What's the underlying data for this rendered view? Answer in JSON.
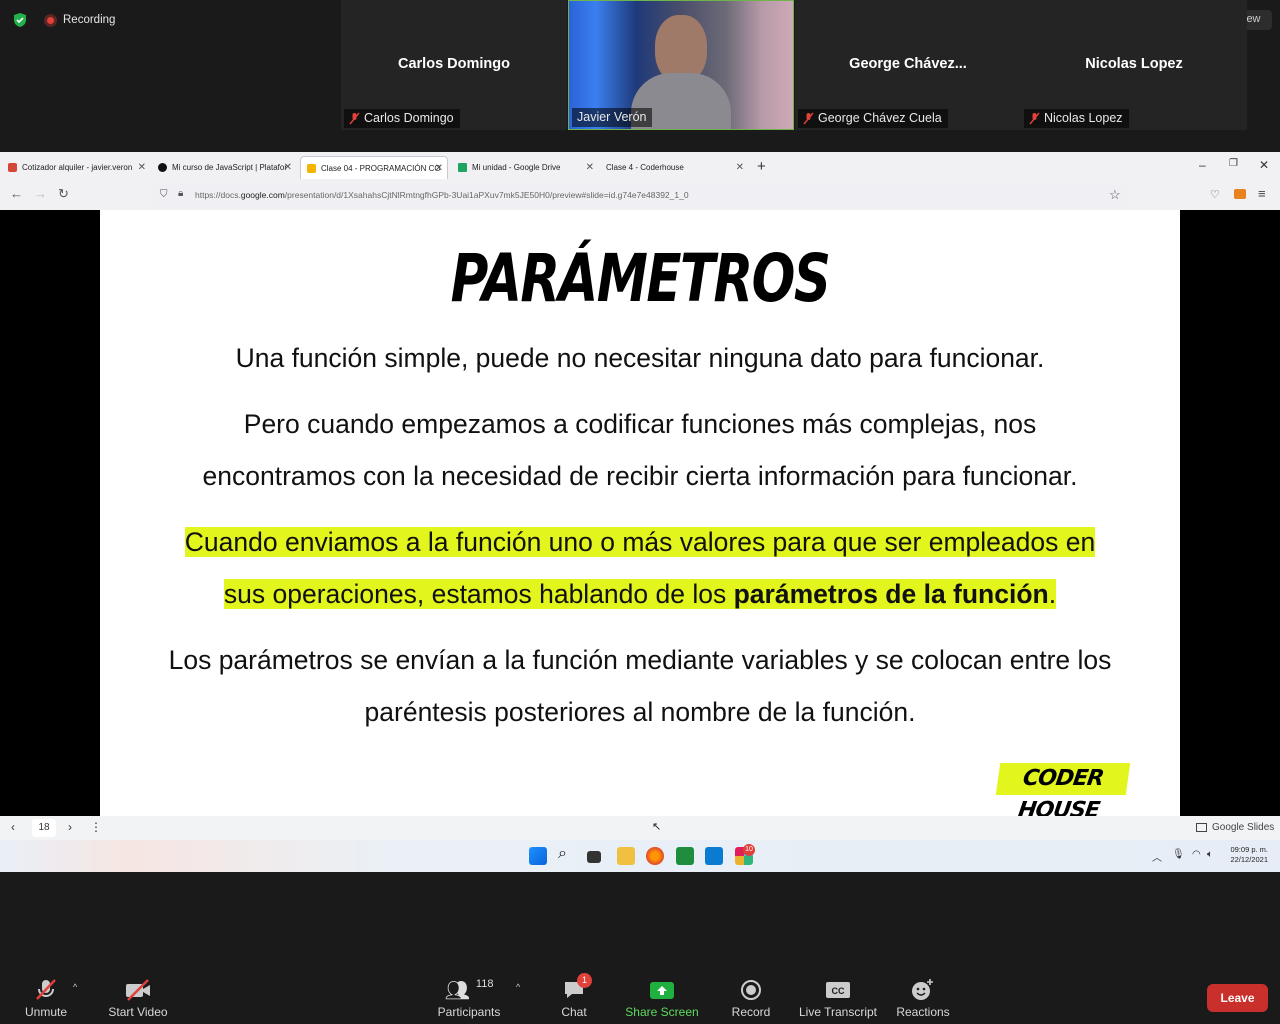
{
  "zoom_top": {
    "recording_label": "Recording",
    "view_label": "iew",
    "participants": [
      {
        "name": "Carlos Domingo",
        "label": "Carlos Domingo"
      },
      {
        "name": "",
        "label": "Javier Verón"
      },
      {
        "name": "George  Chávez...",
        "label": "George Chávez Cuela"
      },
      {
        "name": "Nicolas Lopez",
        "label": "Nicolas Lopez"
      }
    ]
  },
  "browser": {
    "tabs": [
      {
        "label": "Cotizador alquiler - javier.veron",
        "color": "#d44638"
      },
      {
        "label": "Mi curso de JavaScript | Platafor",
        "color": "#111111"
      },
      {
        "label": "Clase 04 - PROGRAMACIÓN CO",
        "color": "#f4b400"
      },
      {
        "label": "Mi unidad - Google Drive",
        "color": "#1fa463"
      },
      {
        "label": "Clase 4 - Coderhouse",
        "color": ""
      }
    ],
    "url_prefix": "https://docs.",
    "url_domain": "google.com",
    "url_rest": "/presentation/d/1XsahahsCjtNlRmtngfhGPb-3Uai1aPXuv7mk5JE50H0/preview#slide=id.g74e7e48392_1_0"
  },
  "slide": {
    "title": "PARÁMETROS",
    "p1": "Una función simple, puede no necesitar ninguna dato para funcionar.",
    "p2a": "Pero cuando empezamos a codificar funciones más complejas, nos",
    "p2b": "encontramos con la necesidad de recibir cierta información para funcionar.",
    "p3a": "Cuando enviamos a la función uno o más valores para que ser empleados en",
    "p3b": "sus operaciones, estamos hablando de los ",
    "p3b_bold": "parámetros de la función",
    "p3b_end": ".",
    "p4a": "Los parámetros se envían a la función mediante variables y se colocan entre los",
    "p4b": "paréntesis posteriores al nombre de la función.",
    "logo": "CODER HOUSE",
    "highlight_color": "#e2f51d"
  },
  "slides_bar": {
    "page": "18",
    "app_label": "Google Slides"
  },
  "taskbar": {
    "time": "09:09 p. m.",
    "date": "22/12/2021",
    "slack_badge": "10"
  },
  "zoom_bottom": {
    "unmute": "Unmute",
    "start_video": "Start Video",
    "participants": "Participants",
    "participants_count": "118",
    "chat": "Chat",
    "chat_badge": "1",
    "share_screen": "Share Screen",
    "record": "Record",
    "live_transcript": "Live Transcript",
    "reactions": "Reactions",
    "leave": "Leave"
  }
}
